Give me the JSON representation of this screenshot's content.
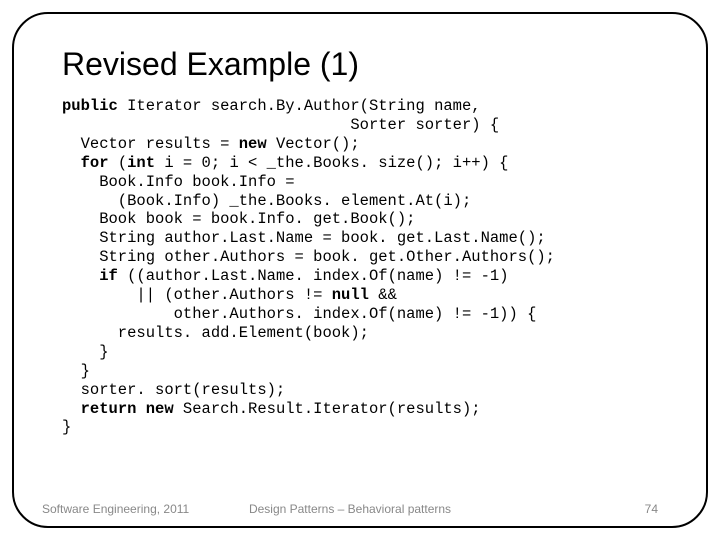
{
  "title": "Revised Example (1)",
  "code": {
    "l1a": "public",
    "l1b": " Iterator search.By.Author(String name,",
    "l2a": "                               Sorter sorter) {",
    "l3a": "  Vector results = ",
    "l3b": "new",
    "l3c": " Vector();",
    "l4a": "  ",
    "l4b": "for",
    "l4c": " (",
    "l4d": "int",
    "l4e": " i = 0; i < _the.Books. size(); i++) {",
    "l5a": "    Book.Info book.Info =",
    "l6a": "      (Book.Info) _the.Books. element.At(i);",
    "l7a": "    Book book = book.Info. get.Book();",
    "l8a": "    String author.Last.Name = book. get.Last.Name();",
    "l9a": "    String other.Authors = book. get.Other.Authors();",
    "l10a": "    ",
    "l10b": "if",
    "l10c": " ((author.Last.Name. index.Of(name) != -1)",
    "l11a": "        || (other.Authors != ",
    "l11b": "null",
    "l11c": " &&",
    "l12a": "            other.Authors. index.Of(name) != -1)) {",
    "l13a": "      results. add.Element(book);",
    "l14a": "    }",
    "l15a": "  }",
    "l16a": "  sorter. sort(results);",
    "l17a": "  ",
    "l17b": "return new",
    "l17c": " Search.Result.Iterator(results);",
    "l18a": "}"
  },
  "footer": {
    "left": "Software Engineering, 2011",
    "center": "Design Patterns – Behavioral patterns",
    "right": "74"
  }
}
